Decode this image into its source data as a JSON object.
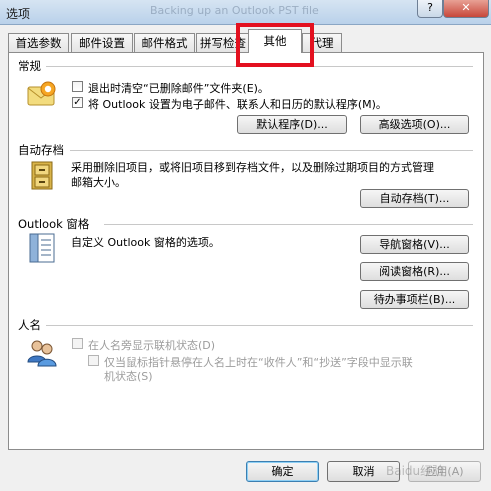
{
  "window": {
    "title": "选项",
    "background_title": "Backing up an Outlook PST file"
  },
  "tabs": [
    {
      "label": "首选参数"
    },
    {
      "label": "邮件设置"
    },
    {
      "label": "邮件格式"
    },
    {
      "label": "拼写检查"
    },
    {
      "label": "其他"
    },
    {
      "label": "代理"
    }
  ],
  "active_tab": "其他",
  "sections": {
    "general": {
      "title": "常规",
      "empty_deleted": {
        "label": "退出时清空“已删除邮件”文件夹(E)。",
        "checked": false
      },
      "default_program": {
        "label": "将 Outlook 设置为电子邮件、联系人和日历的默认程序(M)。",
        "checked": true
      },
      "default_program_button": "默认程序(D)...",
      "advanced_button": "高级选项(O)..."
    },
    "autoarchive": {
      "title": "自动存档",
      "desc_line1": "采用删除旧项目，或将旧项目移到存档文件，以及删除过期项目的方式管理",
      "desc_line2": "邮箱大小。",
      "button": "自动存档(T)..."
    },
    "outlook_panes": {
      "title": "Outlook 窗格",
      "desc": "自定义 Outlook 窗格的选项。",
      "nav_button": "导航窗格(V)...",
      "reading_button": "阅读窗格(R)...",
      "todo_button": "待办事项栏(B)..."
    },
    "person_names": {
      "title": "人名",
      "show_online": {
        "label": "在人名旁显示联机状态(D)",
        "checked": false,
        "enabled": false
      },
      "hover_only": {
        "label_line1": "仅当鼠标指针悬停在人名上时在“收件人”和“抄送”字段中显示联",
        "label_line2": "机状态(S)",
        "checked": false,
        "enabled": false
      }
    }
  },
  "footer": {
    "ok": "确定",
    "cancel": "取消",
    "apply": "应用(A)"
  },
  "watermark": "Baidu经验",
  "colors": {
    "highlight": "#e3101f",
    "panel": "#ffffff",
    "window": "#f0f0f0"
  }
}
